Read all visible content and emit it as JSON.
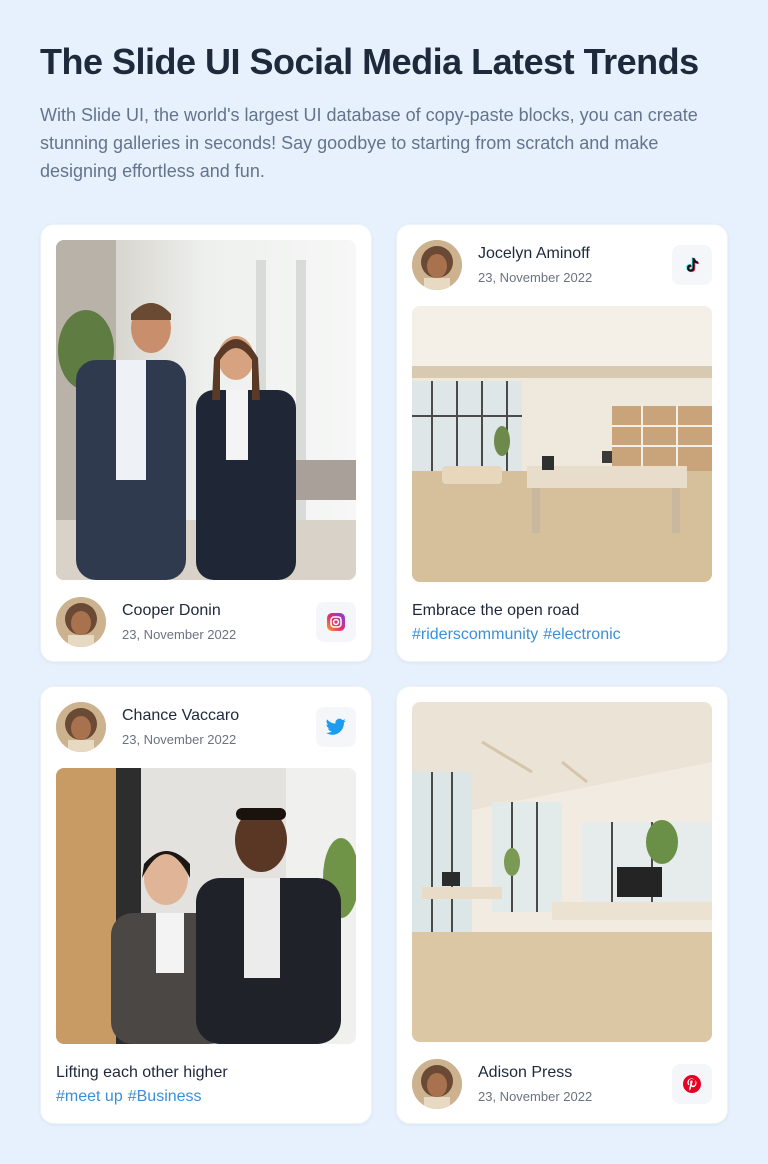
{
  "header": {
    "title": "The Slide UI Social Media Latest Trends",
    "description": "With Slide UI, the world's largest UI database of copy-paste blocks, you can create stunning galleries in seconds! Say goodbye to starting from scratch and make designing effortless and fun."
  },
  "cards": [
    {
      "author": "Cooper Donin",
      "date": "23, November 2022",
      "network": "instagram-icon"
    },
    {
      "author": "Jocelyn Aminoff",
      "date": "23, November 2022",
      "network": "tiktok-icon",
      "caption": "Embrace the open road",
      "tags": [
        "#riderscommunity",
        "#electronic"
      ]
    },
    {
      "author": "Chance Vaccaro",
      "date": "23, November 2022",
      "network": "twitter-icon",
      "caption": "Lifting each other higher",
      "tags": [
        "#meet up",
        "#Business"
      ]
    },
    {
      "author": "Adison Press",
      "date": "23, November 2022",
      "network": "pinterest-icon"
    }
  ],
  "colors": {
    "background": "#e6f1fd",
    "hashtag": "#3b8fd9",
    "twitter": "#1d9bf0",
    "pinterest": "#e60023"
  }
}
